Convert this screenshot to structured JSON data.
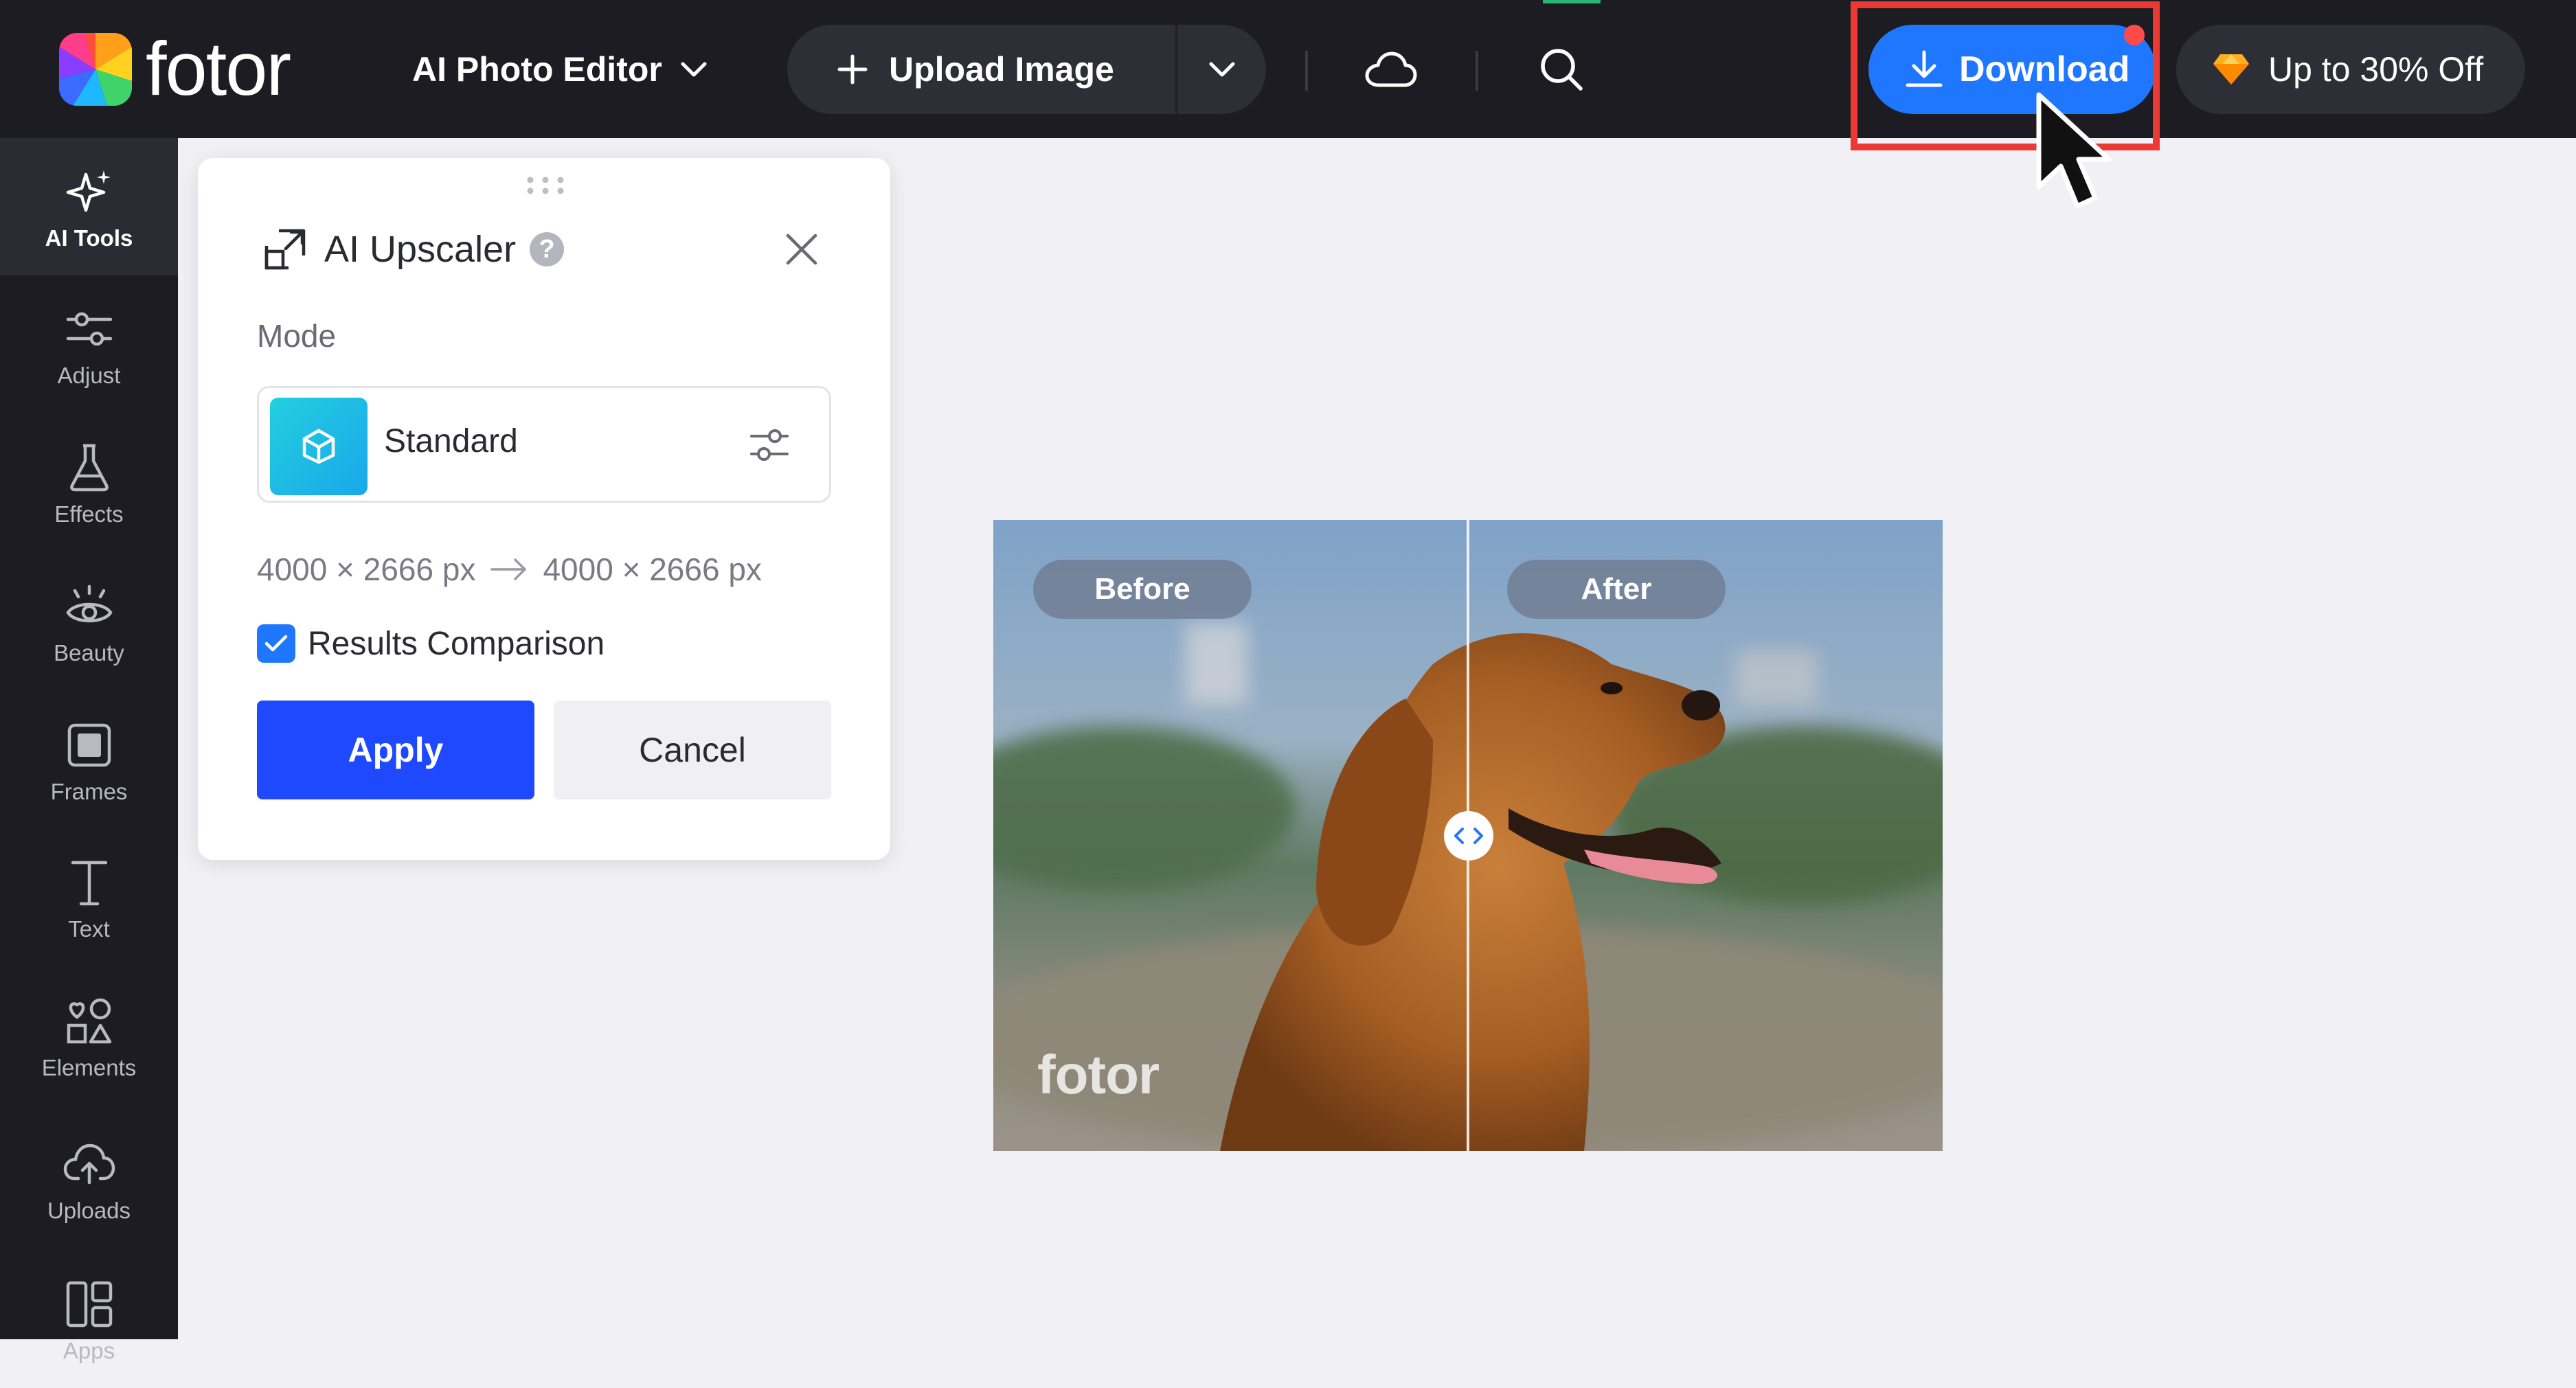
{
  "topbar": {
    "logo_text": "fotor",
    "editor_menu_label": "AI Photo Editor",
    "upload_label": "Upload Image",
    "download_label": "Download",
    "promo_label": "Up to 30% Off"
  },
  "sidebar": {
    "items": [
      {
        "label": "AI Tools"
      },
      {
        "label": "Adjust"
      },
      {
        "label": "Effects"
      },
      {
        "label": "Beauty"
      },
      {
        "label": "Frames"
      },
      {
        "label": "Text"
      },
      {
        "label": "Elements"
      },
      {
        "label": "Uploads"
      },
      {
        "label": "Apps"
      }
    ]
  },
  "panel": {
    "title": "AI Upscaler",
    "help_glyph": "?",
    "mode_label": "Mode",
    "mode_value": "Standard",
    "dims_from": "4000 × 2666 px",
    "dims_to": "4000 × 2666 px",
    "comparison_label": "Results Comparison",
    "comparison_checked": true,
    "apply_label": "Apply",
    "cancel_label": "Cancel"
  },
  "canvas": {
    "before_label": "Before",
    "after_label": "After",
    "watermark": "fotor"
  },
  "colors": {
    "accent_blue": "#1f77ff",
    "apply_blue": "#1f49ff",
    "highlight_red": "#ea3a33",
    "dark_bg": "#1c1c22"
  }
}
